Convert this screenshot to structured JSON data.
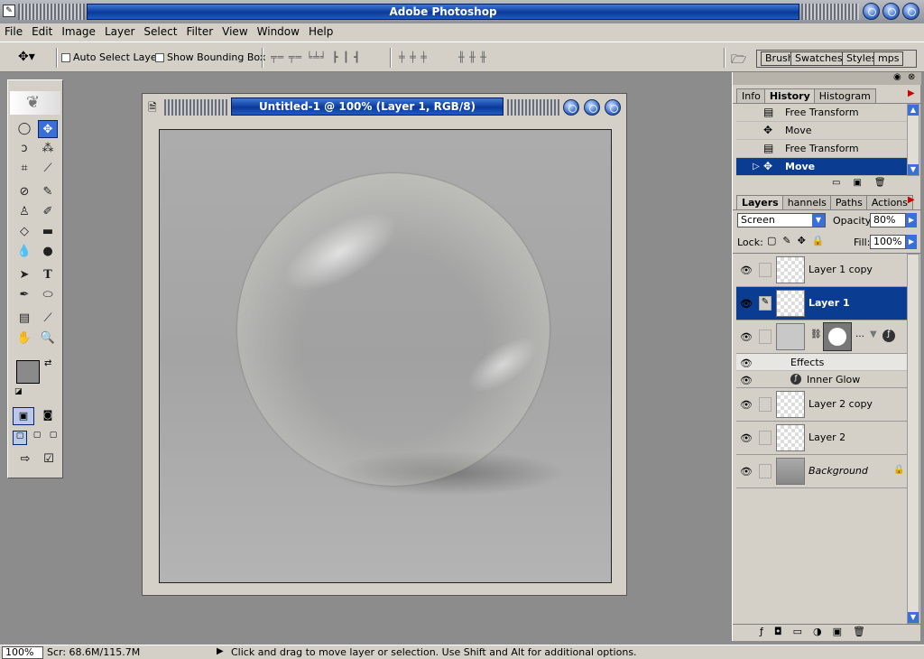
{
  "app": {
    "title": "Adobe Photoshop"
  },
  "menu": {
    "items": [
      "File",
      "Edit",
      "Image",
      "Layer",
      "Select",
      "Filter",
      "View",
      "Window",
      "Help"
    ]
  },
  "options": {
    "auto_select_label": "Auto Select Layer",
    "bounding_box_label": "Show Bounding Box",
    "well_tabs": [
      "Brush",
      "Swatches",
      "Styles",
      "mps"
    ]
  },
  "document": {
    "title": "Untitled-1 @ 100% (Layer 1, RGB/8)"
  },
  "history_panel": {
    "tabs": [
      "Info",
      "History",
      "Histogram"
    ],
    "items": [
      {
        "label": "Free Transform",
        "icon": "transform-icon"
      },
      {
        "label": "Move",
        "icon": "move-icon"
      },
      {
        "label": "Free Transform",
        "icon": "transform-icon"
      },
      {
        "label": "Move",
        "icon": "move-icon",
        "selected": true
      }
    ]
  },
  "layers_panel": {
    "tabs": [
      "Layers",
      "hannels",
      "Paths",
      "Actions"
    ],
    "blend_mode": "Screen",
    "opacity_label": "Opacity:",
    "opacity": "80%",
    "lock_label": "Lock:",
    "fill_label": "Fill:",
    "fill": "100%",
    "layers": [
      {
        "name": "Layer 1 copy"
      },
      {
        "name": "Layer 1",
        "selected": true
      },
      {
        "name": "",
        "type": "adjustment"
      },
      {
        "name": "Layer 2 copy"
      },
      {
        "name": "Layer 2"
      },
      {
        "name": "Background",
        "locked": true
      }
    ],
    "effects_label": "Effects",
    "effect_item": "Inner Glow"
  },
  "status": {
    "zoom": "100%",
    "scratch": "Scr: 68.6M/115.7M",
    "message": "Click and drag to move layer or selection.  Use Shift and Alt for additional options."
  },
  "colors": {
    "title_blue": "#0a3a9a",
    "selection": "#0a3d91",
    "chrome": "#d4d0c8",
    "workspace": "#8c8c8c"
  }
}
